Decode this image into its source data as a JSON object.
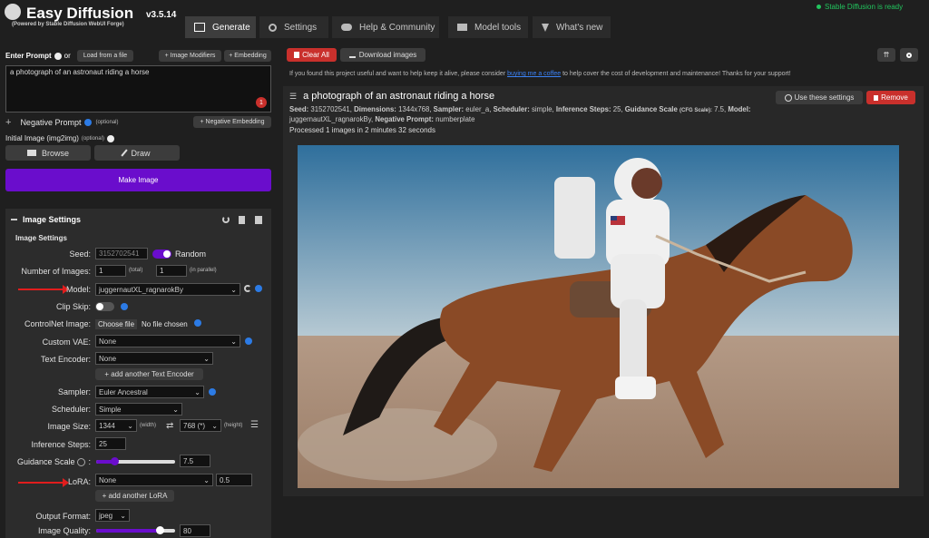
{
  "app": {
    "title": "Easy Diffusion",
    "version": "v3.5.14",
    "powered": "(Powered by Stable Diffusion WebUI Forge)",
    "status": "Stable Diffusion is ready"
  },
  "tabs": [
    {
      "label": "Generate"
    },
    {
      "label": "Settings"
    },
    {
      "label": "Help & Community"
    },
    {
      "label": "Model tools"
    },
    {
      "label": "What's new"
    }
  ],
  "prompt": {
    "label": "Enter Prompt",
    "or": "or",
    "load_file": "Load from a file",
    "image_modifiers": "+ Image Modifiers",
    "embedding": "+ Embedding",
    "value": "a photograph of an astronaut riding a horse",
    "count": "1",
    "neg_label": "Negative Prompt",
    "optional": "(optional)",
    "neg_embedding": "+ Negative Embedding",
    "init_label": "Initial Image (img2img)",
    "init_optional": "(optional)",
    "browse": "Browse",
    "draw": "Draw",
    "make_image": "Make Image"
  },
  "settings": {
    "header": "Image Settings",
    "subheader": "Image Settings",
    "seed_label": "Seed:",
    "seed_value": "3152702541",
    "random_label": "Random",
    "num_label": "Number of Images:",
    "num_total": "1",
    "total": "(total)",
    "num_parallel": "1",
    "parallel": "(in parallel)",
    "model_label": "Model:",
    "model_value": "juggernautXL_ragnarokBy",
    "clip_label": "Clip Skip:",
    "cn_label": "ControlNet Image:",
    "cn_choose": "Choose file",
    "cn_none": "No file chosen",
    "vae_label": "Custom VAE:",
    "vae_value": "None",
    "te_label": "Text Encoder:",
    "te_value": "None",
    "te_add": "+ add another Text Encoder",
    "sampler_label": "Sampler:",
    "sampler_value": "Euler Ancestral",
    "scheduler_label": "Scheduler:",
    "scheduler_value": "Simple",
    "size_label": "Image Size:",
    "width_value": "1344",
    "width": "(width)",
    "height_value": "768 (*)",
    "height": "(height)",
    "steps_label": "Inference Steps:",
    "steps_value": "25",
    "guidance_label": "Guidance Scale",
    "guidance_value": "7.5",
    "guidance_fraction": 0.23,
    "lora_label": "LoRA:",
    "lora_value": "None",
    "lora_weight": "0.5",
    "lora_add": "+ add another LoRA",
    "format_label": "Output Format:",
    "format_value": "jpeg",
    "quality_label": "Image Quality:",
    "quality_value": "80",
    "quality_fraction": 0.8
  },
  "main": {
    "clear_all": "Clear All",
    "download": "Download images",
    "notice_pre": "If you found this project useful and want to help keep it alive, please consider ",
    "notice_link": "buying me a coffee",
    "notice_post": " to help cover the cost of development and maintenance! Thanks for your support!",
    "result_title": "a photograph of an astronaut riding a horse",
    "use_settings": "Use these settings",
    "remove": "Remove",
    "meta": [
      {
        "k": "Seed:",
        "v": " 3152702541, "
      },
      {
        "k": "Dimensions:",
        "v": " 1344x768, "
      },
      {
        "k": "Sampler:",
        "v": " euler_a, "
      },
      {
        "k": "Scheduler:",
        "v": " simple, "
      },
      {
        "k": "Inference Steps:",
        "v": " 25, "
      },
      {
        "k": "Guidance Scale",
        "v": ""
      },
      {
        "k": "(CFG Scale):",
        "v": " 7.5, "
      },
      {
        "k": "Model:",
        "v": ""
      }
    ],
    "meta2_v": "juggernautXL_ragnarokBy, ",
    "meta2_k": "Negative Prompt:",
    "meta2_v2": " numberplate",
    "processed": "Processed 1 images in 2 minutes 32 seconds"
  },
  "colors": {
    "accent": "#6a0dcc",
    "danger": "#c9302c",
    "ready": "#22c55e",
    "link": "#3b82f6"
  }
}
